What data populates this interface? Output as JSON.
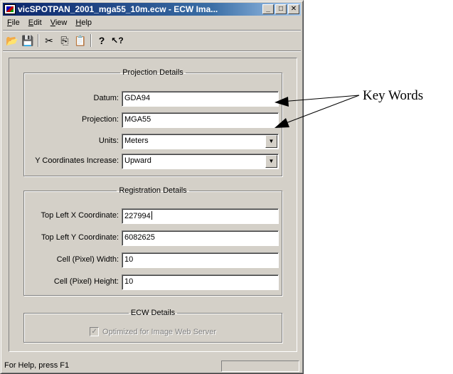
{
  "window": {
    "title": "vicSPOTPAN_2001_mga55_10m.ecw - ECW Ima...",
    "controls": {
      "minimize": "_",
      "maximize": "□",
      "close": "✕"
    }
  },
  "menu": [
    {
      "accel": "F",
      "rest": "ile"
    },
    {
      "accel": "E",
      "rest": "dit"
    },
    {
      "accel": "V",
      "rest": "iew"
    },
    {
      "accel": "H",
      "rest": "elp"
    }
  ],
  "toolbar": {
    "icons": [
      "open-folder-icon",
      "save-disk-icon",
      "cut-scissors-icon",
      "copy-icon",
      "paste-icon",
      "help-icon",
      "context-help-icon"
    ],
    "glyphs": {
      "open": "📂",
      "save": "💾",
      "cut": "✂",
      "copy": "⎘",
      "paste": "📋",
      "help": "?",
      "context_help": "↖?"
    }
  },
  "projection": {
    "legend": "Projection Details",
    "datum": {
      "label": "Datum:",
      "value": "GDA94"
    },
    "projection": {
      "label": "Projection:",
      "value": "MGA55"
    },
    "units": {
      "label": "Units:",
      "value": "Meters"
    },
    "y_increase": {
      "label": "Y Coordinates Increase:",
      "value": "Upward"
    },
    "dropdown_glyph": "▼"
  },
  "registration": {
    "legend": "Registration Details",
    "top_left_x": {
      "label": "Top Left X Coordinate:",
      "value": "227994"
    },
    "top_left_y": {
      "label": "Top Left Y Coordinate:",
      "value": "6082625"
    },
    "cell_width": {
      "label": "Cell (Pixel) Width:",
      "value": "10"
    },
    "cell_height": {
      "label": "Cell (Pixel) Height:",
      "value": "10"
    }
  },
  "ecw": {
    "legend": "ECW Details",
    "optimized": {
      "label": "Optimized for Image Web Server",
      "checked": true,
      "enabled": false,
      "mark": "✓"
    }
  },
  "statusbar": {
    "text": "For Help, press F1"
  },
  "annotation": {
    "text": "Key Words"
  },
  "colors": {
    "face": "#d4d0c8",
    "title_start": "#0a246a",
    "title_end": "#a6caf0",
    "disabled_text": "#808080"
  }
}
